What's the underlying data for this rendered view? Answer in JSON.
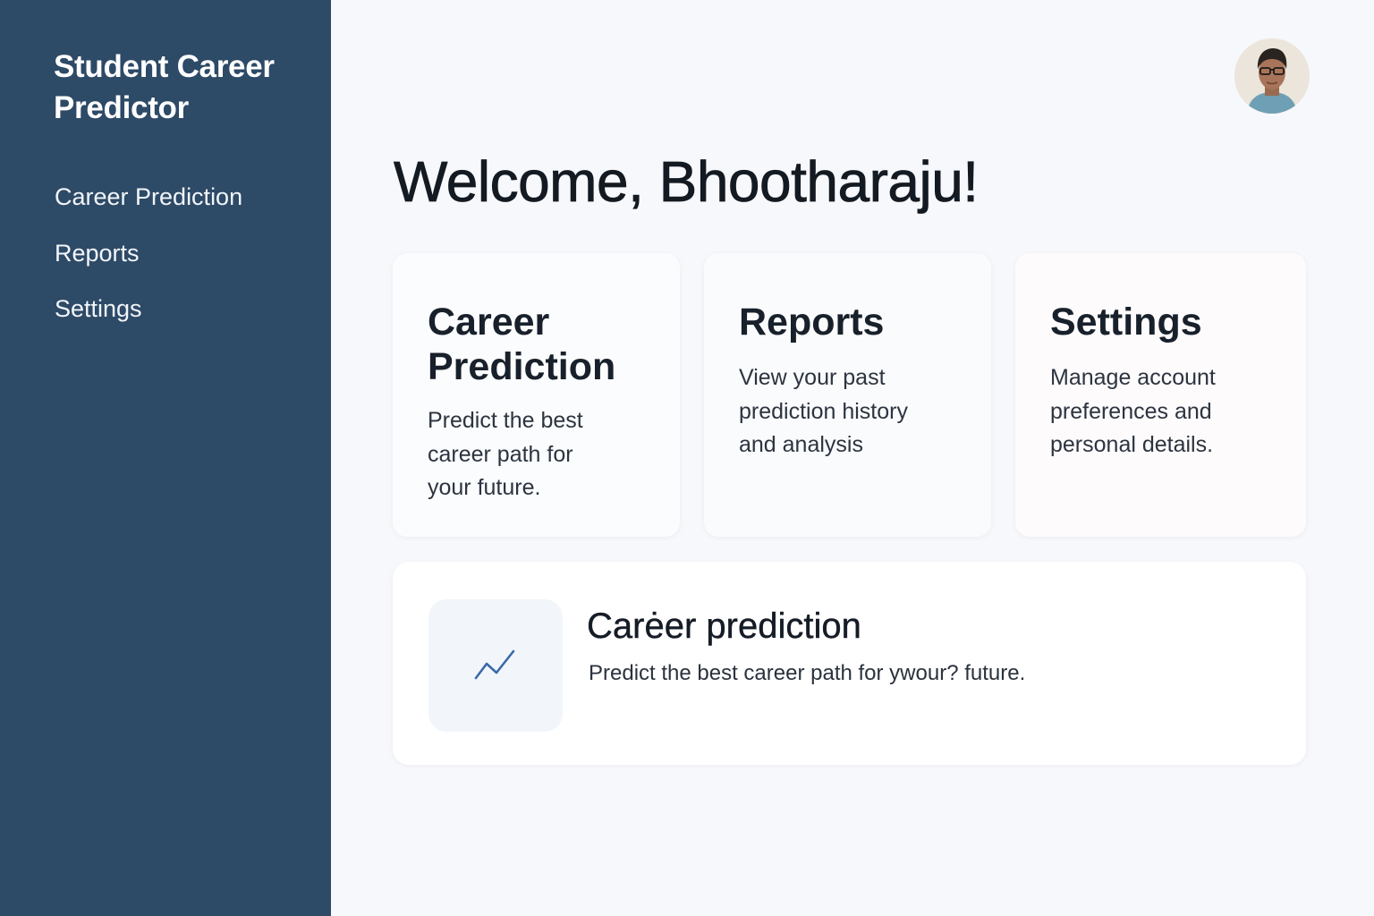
{
  "sidebar": {
    "app_title": "Student Career Predictor",
    "nav": [
      {
        "label": "Career Prediction"
      },
      {
        "label": "Reports"
      },
      {
        "label": "Settings"
      }
    ]
  },
  "header": {
    "welcome": "Welcome, Bhootharaju!",
    "avatar_icon": "user-avatar"
  },
  "cards": [
    {
      "title": "Career Prediction",
      "description": "Predict the best career path for your future."
    },
    {
      "title": "Reports",
      "description": "View your past prediction history and analysis"
    },
    {
      "title": "Settings",
      "description": "Manage account preferences and personal details."
    }
  ],
  "feature": {
    "icon": "trend-line-icon",
    "title": "Carėer prediction",
    "description": "Predict the best career path for ywour? future."
  },
  "colors": {
    "sidebar_bg": "#2d4a67",
    "page_bg": "#f7f8fb",
    "accent": "#3a6aa8"
  }
}
